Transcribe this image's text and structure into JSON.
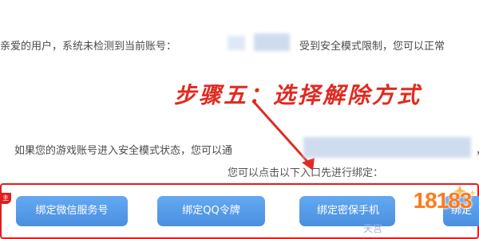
{
  "notice": {
    "line1_start": "亲爱的用户，系统未检测到当前账号：",
    "line1_end": "受到安全模式限制，您可以正常",
    "line2_start": "如果您的游戏账号进入安全模式状态，您可以通",
    "line2_end": "，如",
    "prompt": "您可以点击以下入口先进行绑定："
  },
  "annotation": {
    "step_label": "步骤五：选择解除方式",
    "color": "#e02a20"
  },
  "buttons": [
    {
      "label": "绑定微信服务号"
    },
    {
      "label": "绑定QQ令牌"
    },
    {
      "label": "绑定密保手机"
    },
    {
      "label": "绑定"
    }
  ],
  "badge": {
    "text": "主手"
  },
  "watermark": {
    "text": "18183"
  },
  "partial_bottom": "天宫"
}
